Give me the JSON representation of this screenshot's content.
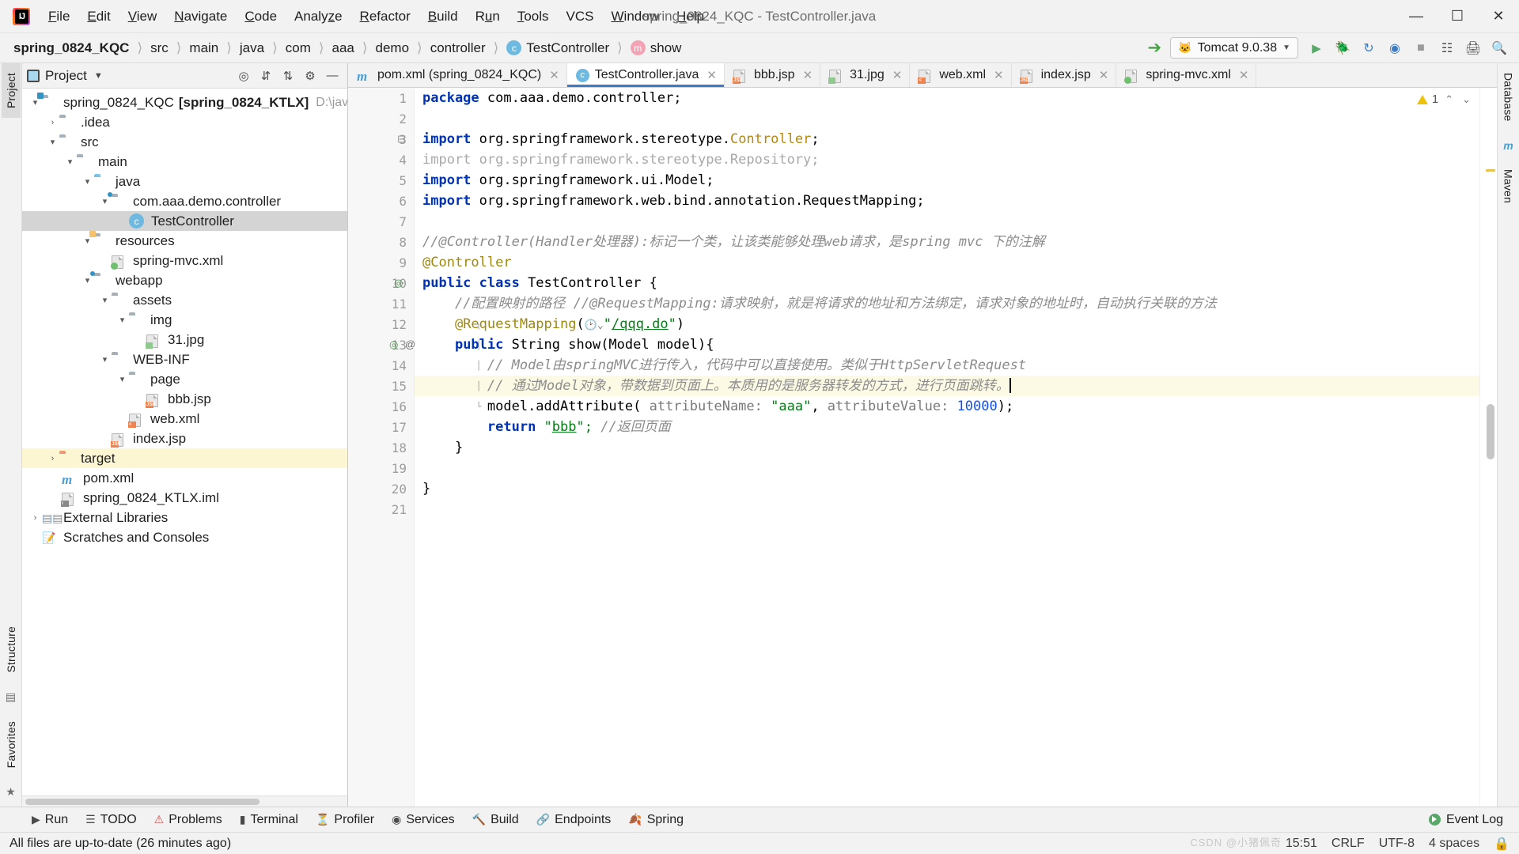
{
  "window": {
    "title": "spring_0824_KQC - TestController.java",
    "minimize": "—",
    "maximize": "▢",
    "close": "✕"
  },
  "menu": [
    {
      "label": "File"
    },
    {
      "label": "Edit"
    },
    {
      "label": "View"
    },
    {
      "label": "Navigate"
    },
    {
      "label": "Code"
    },
    {
      "label": "Analyze"
    },
    {
      "label": "Refactor"
    },
    {
      "label": "Build"
    },
    {
      "label": "Run"
    },
    {
      "label": "Tools"
    },
    {
      "label": "VCS"
    },
    {
      "label": "Window"
    },
    {
      "label": "Help"
    }
  ],
  "breadcrumb": [
    {
      "label": "spring_0824_KQC",
      "icon": "none",
      "bold": true
    },
    {
      "label": "src",
      "icon": "none",
      "bold": false
    },
    {
      "label": "main",
      "icon": "none",
      "bold": false
    },
    {
      "label": "java",
      "icon": "none",
      "bold": false
    },
    {
      "label": "com",
      "icon": "none",
      "bold": false
    },
    {
      "label": "aaa",
      "icon": "none",
      "bold": false
    },
    {
      "label": "demo",
      "icon": "none",
      "bold": false
    },
    {
      "label": "controller",
      "icon": "none",
      "bold": false
    },
    {
      "label": "TestController",
      "icon": "class-icon",
      "bold": false
    },
    {
      "label": "show",
      "icon": "method-icon",
      "bold": false
    }
  ],
  "toolbar": {
    "build_icon": "hammer-icon",
    "run_config": "Tomcat 9.0.38",
    "run_config_icon": "tomcat-icon",
    "dropdown_icon": "chevron-down-icon",
    "run_icon": "run-icon",
    "debug_icon": "debug-icon",
    "rerun_icon": "rerun-icon",
    "coverage_icon": "coverage-icon",
    "stop_icon": "stop-icon",
    "layout_icon": "layout-icon",
    "updates_icon": "updates-icon",
    "search_icon": "search-icon"
  },
  "left_strip": [
    {
      "label": "Project",
      "selected": true
    },
    {
      "label": "Structure",
      "selected": false
    },
    {
      "label": "Favorites",
      "selected": false
    }
  ],
  "right_strip": [
    {
      "label": "Database",
      "selected": false
    },
    {
      "label": "Maven",
      "selected": false
    }
  ],
  "project_panel": {
    "title": "Project",
    "caret": "▾",
    "actions": [
      "locate-icon",
      "expand-all-icon",
      "collapse-all-icon",
      "settings-icon",
      "hide-icon"
    ],
    "tree": [
      {
        "depth": 0,
        "arrow": "▾",
        "icon": "folder-module",
        "label": "spring_0824_KQC",
        "bold_suffix": "[spring_0824_KTLX]",
        "path": "D:\\java-bati",
        "state": "normal"
      },
      {
        "depth": 1,
        "arrow": "›",
        "icon": "folder",
        "label": ".idea",
        "state": "normal"
      },
      {
        "depth": 1,
        "arrow": "▾",
        "icon": "folder",
        "label": "src",
        "state": "normal"
      },
      {
        "depth": 2,
        "arrow": "▾",
        "icon": "folder",
        "label": "main",
        "state": "normal"
      },
      {
        "depth": 3,
        "arrow": "▾",
        "icon": "folder-source",
        "label": "java",
        "state": "normal"
      },
      {
        "depth": 4,
        "arrow": "▾",
        "icon": "folder-package",
        "label": "com.aaa.demo.controller",
        "state": "normal"
      },
      {
        "depth": 5,
        "arrow": "",
        "icon": "class-icon",
        "label": "TestController",
        "state": "selected"
      },
      {
        "depth": 3,
        "arrow": "▾",
        "icon": "folder-resources",
        "label": "resources",
        "state": "normal"
      },
      {
        "depth": 4,
        "arrow": "",
        "icon": "spring-xml-icon",
        "label": "spring-mvc.xml",
        "state": "normal"
      },
      {
        "depth": 3,
        "arrow": "▾",
        "icon": "folder-webapp",
        "label": "webapp",
        "state": "normal"
      },
      {
        "depth": 4,
        "arrow": "▾",
        "icon": "folder",
        "label": "assets",
        "state": "normal"
      },
      {
        "depth": 5,
        "arrow": "▾",
        "icon": "folder",
        "label": "img",
        "state": "normal"
      },
      {
        "depth": 6,
        "arrow": "",
        "icon": "image-icon",
        "label": "31.jpg",
        "state": "normal"
      },
      {
        "depth": 4,
        "arrow": "▾",
        "icon": "folder",
        "label": "WEB-INF",
        "state": "normal"
      },
      {
        "depth": 5,
        "arrow": "▾",
        "icon": "folder",
        "label": "page",
        "state": "normal"
      },
      {
        "depth": 6,
        "arrow": "",
        "icon": "jsp-icon",
        "label": "bbb.jsp",
        "state": "normal"
      },
      {
        "depth": 5,
        "arrow": "",
        "icon": "webxml-icon",
        "label": "web.xml",
        "state": "normal"
      },
      {
        "depth": 4,
        "arrow": "",
        "icon": "jsp-icon",
        "label": "index.jsp",
        "state": "normal"
      },
      {
        "depth": 1,
        "arrow": "›",
        "icon": "folder-target",
        "label": "target",
        "state": "highlight"
      },
      {
        "depth": 1,
        "arrow": "",
        "icon": "maven-icon",
        "label": "pom.xml",
        "state": "normal"
      },
      {
        "depth": 1,
        "arrow": "",
        "icon": "iml-icon",
        "label": "spring_0824_KTLX.iml",
        "state": "normal"
      },
      {
        "depth": 0,
        "arrow": "›",
        "icon": "libraries-icon",
        "label": "External Libraries",
        "state": "normal"
      },
      {
        "depth": 0,
        "arrow": "",
        "icon": "scratches-icon",
        "label": "Scratches and Consoles",
        "state": "normal"
      }
    ]
  },
  "editor_tabs": [
    {
      "label": "pom.xml (spring_0824_KQC)",
      "icon": "maven-icon",
      "active": false,
      "close": "✕"
    },
    {
      "label": "TestController.java",
      "icon": "class-icon",
      "active": true,
      "close": "✕"
    },
    {
      "label": "bbb.jsp",
      "icon": "jsp-icon",
      "active": false,
      "close": "✕"
    },
    {
      "label": "31.jpg",
      "icon": "image-icon",
      "active": false,
      "close": "✕"
    },
    {
      "label": "web.xml",
      "icon": "webxml-icon",
      "active": false,
      "close": "✕"
    },
    {
      "label": "index.jsp",
      "icon": "jsp-icon",
      "active": false,
      "close": "✕"
    },
    {
      "label": "spring-mvc.xml",
      "icon": "spring-xml-icon",
      "active": false,
      "close": "✕"
    }
  ],
  "inspection": {
    "count": "1",
    "icon": "warning-triangle-icon",
    "up": "⌃",
    "down": "⌄"
  },
  "code": {
    "line_numbers": [
      "1",
      "2",
      "3",
      "4",
      "5",
      "6",
      "7",
      "8",
      "9",
      "10",
      "11",
      "12",
      "13",
      "14",
      "15",
      "16",
      "17",
      "18",
      "19",
      "20",
      "21"
    ],
    "current_line": 15,
    "lines": [
      {
        "n": 1,
        "tokens": [
          {
            "t": "package ",
            "c": "kw"
          },
          {
            "t": "com.aaa.demo.controller;",
            "c": "kw2"
          }
        ]
      },
      {
        "n": 2,
        "tokens": []
      },
      {
        "n": 3,
        "tokens": [
          {
            "t": "import ",
            "c": "kw"
          },
          {
            "t": "org.springframework.stereotype.",
            "c": "kw2"
          },
          {
            "t": "Controller",
            "c": "cls"
          },
          {
            "t": ";",
            "c": "kw2"
          }
        ]
      },
      {
        "n": 4,
        "tokens": [
          {
            "t": "import org.springframework.stereotype.Repository;",
            "c": "dim"
          }
        ]
      },
      {
        "n": 5,
        "tokens": [
          {
            "t": "import ",
            "c": "kw"
          },
          {
            "t": "org.springframework.ui.Model;",
            "c": "kw2"
          }
        ]
      },
      {
        "n": 6,
        "tokens": [
          {
            "t": "import ",
            "c": "kw"
          },
          {
            "t": "org.springframework.web.bind.annotation.RequestMapping;",
            "c": "kw2"
          }
        ]
      },
      {
        "n": 7,
        "tokens": []
      },
      {
        "n": 8,
        "tokens": [
          {
            "t": "//@Controller(Handler处理器):标记一个类，让该类能够处理web请求，是spring mvc 下的注解",
            "c": "cmt"
          }
        ]
      },
      {
        "n": 9,
        "tokens": [
          {
            "t": "@Controller",
            "c": "anno"
          }
        ]
      },
      {
        "n": 10,
        "tokens": [
          {
            "t": "public class ",
            "c": "kw"
          },
          {
            "t": "TestController {",
            "c": "kw2"
          }
        ]
      },
      {
        "n": 11,
        "tokens": [
          {
            "t": "    //配置映射的路径 //@RequestMapping:请求映射，就是将请求的地址和方法绑定，请求对象的地址时，自动执行关联的方法",
            "c": "cmt"
          }
        ]
      },
      {
        "n": 12,
        "tokens": [
          {
            "t": "    @RequestMapping",
            "c": "anno"
          },
          {
            "t": "(",
            "c": "kw2"
          },
          {
            "t": "🕘⌄",
            "c": "param"
          },
          {
            "t": "\"/qqq.do\"",
            "c": "str"
          },
          {
            "t": ")",
            "c": "kw2"
          }
        ]
      },
      {
        "n": 13,
        "tokens": [
          {
            "t": "    public ",
            "c": "kw"
          },
          {
            "t": "String show(Model model){",
            "c": "kw2"
          }
        ]
      },
      {
        "n": 14,
        "tokens": [
          {
            "t": "        // Model由springMVC进行传入，代码中可以直接使用。类似于HttpServletRequest",
            "c": "cmt"
          }
        ]
      },
      {
        "n": 15,
        "tokens": [
          {
            "t": "        // 通过Model对象，带数据到页面上。本质用的是服务器转发的方式，进行页面跳转。",
            "c": "cmt"
          }
        ]
      },
      {
        "n": 16,
        "tokens": [
          {
            "t": "        model.addAttribute( ",
            "c": "kw2"
          },
          {
            "t": "attributeName:",
            "c": "param"
          },
          {
            "t": " \"aaa\"",
            "c": "str"
          },
          {
            "t": ", ",
            "c": "kw2"
          },
          {
            "t": "attributeValue:",
            "c": "param"
          },
          {
            "t": " ",
            "c": "kw2"
          },
          {
            "t": "10000",
            "c": "num"
          },
          {
            "t": ");",
            "c": "kw2"
          }
        ]
      },
      {
        "n": 17,
        "tokens": [
          {
            "t": "        return ",
            "c": "kw"
          },
          {
            "t": "\"",
            "c": "str"
          },
          {
            "t": "bbb",
            "c": "ulink"
          },
          {
            "t": "\";",
            "c": "str"
          },
          {
            "t": " //返回页面",
            "c": "cmt"
          }
        ]
      },
      {
        "n": 18,
        "tokens": [
          {
            "t": "    }",
            "c": "kw2"
          }
        ]
      },
      {
        "n": 19,
        "tokens": []
      },
      {
        "n": 20,
        "tokens": [
          {
            "t": "}",
            "c": "kw2"
          }
        ]
      },
      {
        "n": 21,
        "tokens": []
      }
    ]
  },
  "bottom_toolbar": [
    {
      "label": "Run",
      "icon": "run-icon"
    },
    {
      "label": "TODO",
      "icon": "todo-icon"
    },
    {
      "label": "Problems",
      "icon": "problems-icon"
    },
    {
      "label": "Terminal",
      "icon": "terminal-icon"
    },
    {
      "label": "Profiler",
      "icon": "profiler-icon"
    },
    {
      "label": "Services",
      "icon": "services-icon"
    },
    {
      "label": "Build",
      "icon": "build-icon"
    },
    {
      "label": "Endpoints",
      "icon": "endpoints-icon"
    },
    {
      "label": "Spring",
      "icon": "spring-icon"
    }
  ],
  "event_log": {
    "label": "Event Log",
    "icon": "event-log-icon"
  },
  "status_bar": {
    "message": "All files are up-to-date (26 minutes ago)",
    "time": "15:51",
    "line_sep": "CRLF",
    "encoding": "UTF-8",
    "indent": "4 spaces",
    "lock_icon": "lock-icon",
    "watermark": "CSDN @小猪佩奇"
  }
}
